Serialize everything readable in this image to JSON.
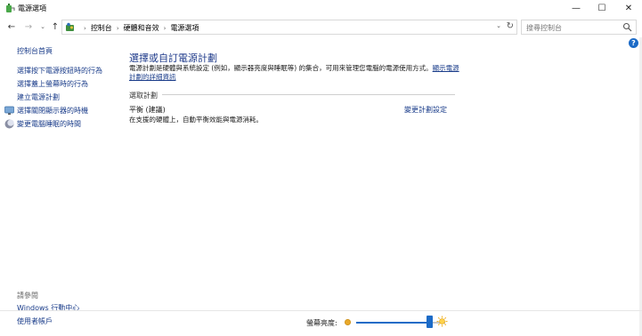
{
  "window": {
    "title": "電源選項",
    "minimize_glyph": "—",
    "maximize_glyph": "☐",
    "close_glyph": "✕"
  },
  "address": {
    "back_glyph": "←",
    "forward_glyph": "→",
    "dropdown_glyph": "⌄",
    "up_glyph": "↑",
    "breadcrumb": [
      "控制台",
      "硬體和音效",
      "電源選項"
    ],
    "separator": "›",
    "refresh_glyph": "↻"
  },
  "search": {
    "placeholder": "搜尋控制台"
  },
  "help_glyph": "?",
  "sidebar": {
    "home": "控制台首頁",
    "items": [
      {
        "label": "選擇按下電源按鈕時的行為",
        "icon": null
      },
      {
        "label": "選擇蓋上螢幕時的行為",
        "icon": null
      },
      {
        "label": "建立電源計劃",
        "icon": null
      },
      {
        "label": "選擇關閉顯示器的時機",
        "icon": "display-icon"
      },
      {
        "label": "變更電腦睡眠的時間",
        "icon": "moon-icon"
      }
    ],
    "see_also": {
      "heading": "請參閱",
      "links": [
        "Windows 行動中心",
        "使用者帳戶"
      ]
    }
  },
  "main": {
    "title": "選擇或自訂電源計劃",
    "description": "電源計劃是硬體與系統設定 (例如，顯示器亮度與睡眠等) 的集合，可用來管理您電腦的電源使用方式。",
    "description_link": "顯示電源計劃的詳細資訊",
    "section_label": "選取計劃",
    "plan": {
      "name": "平衡 (建議)",
      "change_link": "變更計劃設定",
      "description": "在支援的硬體上，自動平衡效能與電源消耗。"
    }
  },
  "brightness": {
    "label": "螢幕亮度:",
    "value_fraction": 0.82,
    "accent": "#1c6bc7"
  }
}
